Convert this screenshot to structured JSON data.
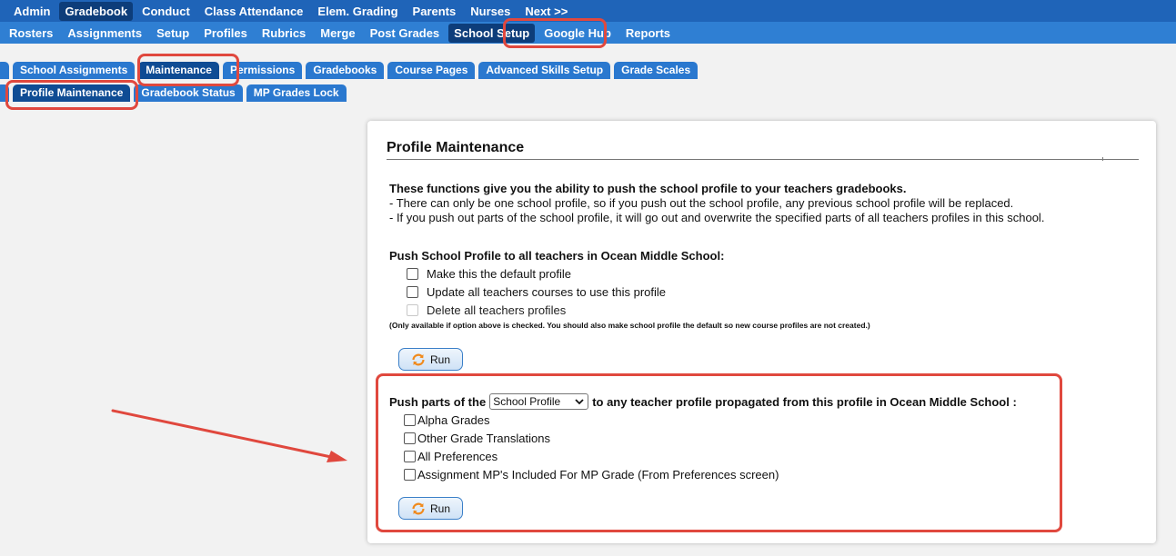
{
  "top_nav": [
    "Admin",
    "Gradebook",
    "Conduct",
    "Class Attendance",
    "Elem. Grading",
    "Parents",
    "Nurses",
    "Next >>"
  ],
  "sub_nav": [
    "Rosters",
    "Assignments",
    "Setup",
    "Profiles",
    "Rubrics",
    "Merge",
    "Post Grades",
    "School Setup",
    "Google Hub",
    "Reports"
  ],
  "tabs": [
    "School Assignments",
    "Maintenance",
    "Permissions",
    "Gradebooks",
    "Course Pages",
    "Advanced Skills Setup",
    "Grade Scales"
  ],
  "subtabs": [
    "Profile Maintenance",
    "Gradebook Status",
    "MP Grades Lock"
  ],
  "panel": {
    "title": "Profile Maintenance",
    "intro_heading": "These functions give you the ability to push the school profile to your teachers gradebooks.",
    "intro_line1": "- There can only be one school profile, so if you push out the school profile, any previous school profile will be replaced.",
    "intro_line2": "- If you push out parts of the school profile, it will go out and overwrite the specified parts of all teachers profiles in this school.",
    "push_heading": "Push School Profile to all teachers in Ocean Middle School:",
    "push_options": [
      "Make this the default profile",
      "Update all teachers courses to use this profile",
      "Delete all teachers profiles"
    ],
    "push_note": "(Only available if option above is checked. You should also make school profile the default so new course profiles are not created.)",
    "run_label": "Run",
    "parts_prefix": "Push parts of the",
    "parts_select": "School Profile",
    "parts_suffix": "to any teacher profile propagated from this profile in Ocean Middle School :",
    "parts_options": [
      "Alpha Grades",
      "Other Grade Translations",
      "All Preferences",
      "Assignment MP's Included For MP Grade (From Preferences screen)"
    ]
  },
  "colors": {
    "nav_dark": "#1f64b8",
    "nav_light": "#2f7fd3",
    "active": "#0d3d7a",
    "highlight": "#e0483e",
    "run_icon": "#f08a1c"
  }
}
